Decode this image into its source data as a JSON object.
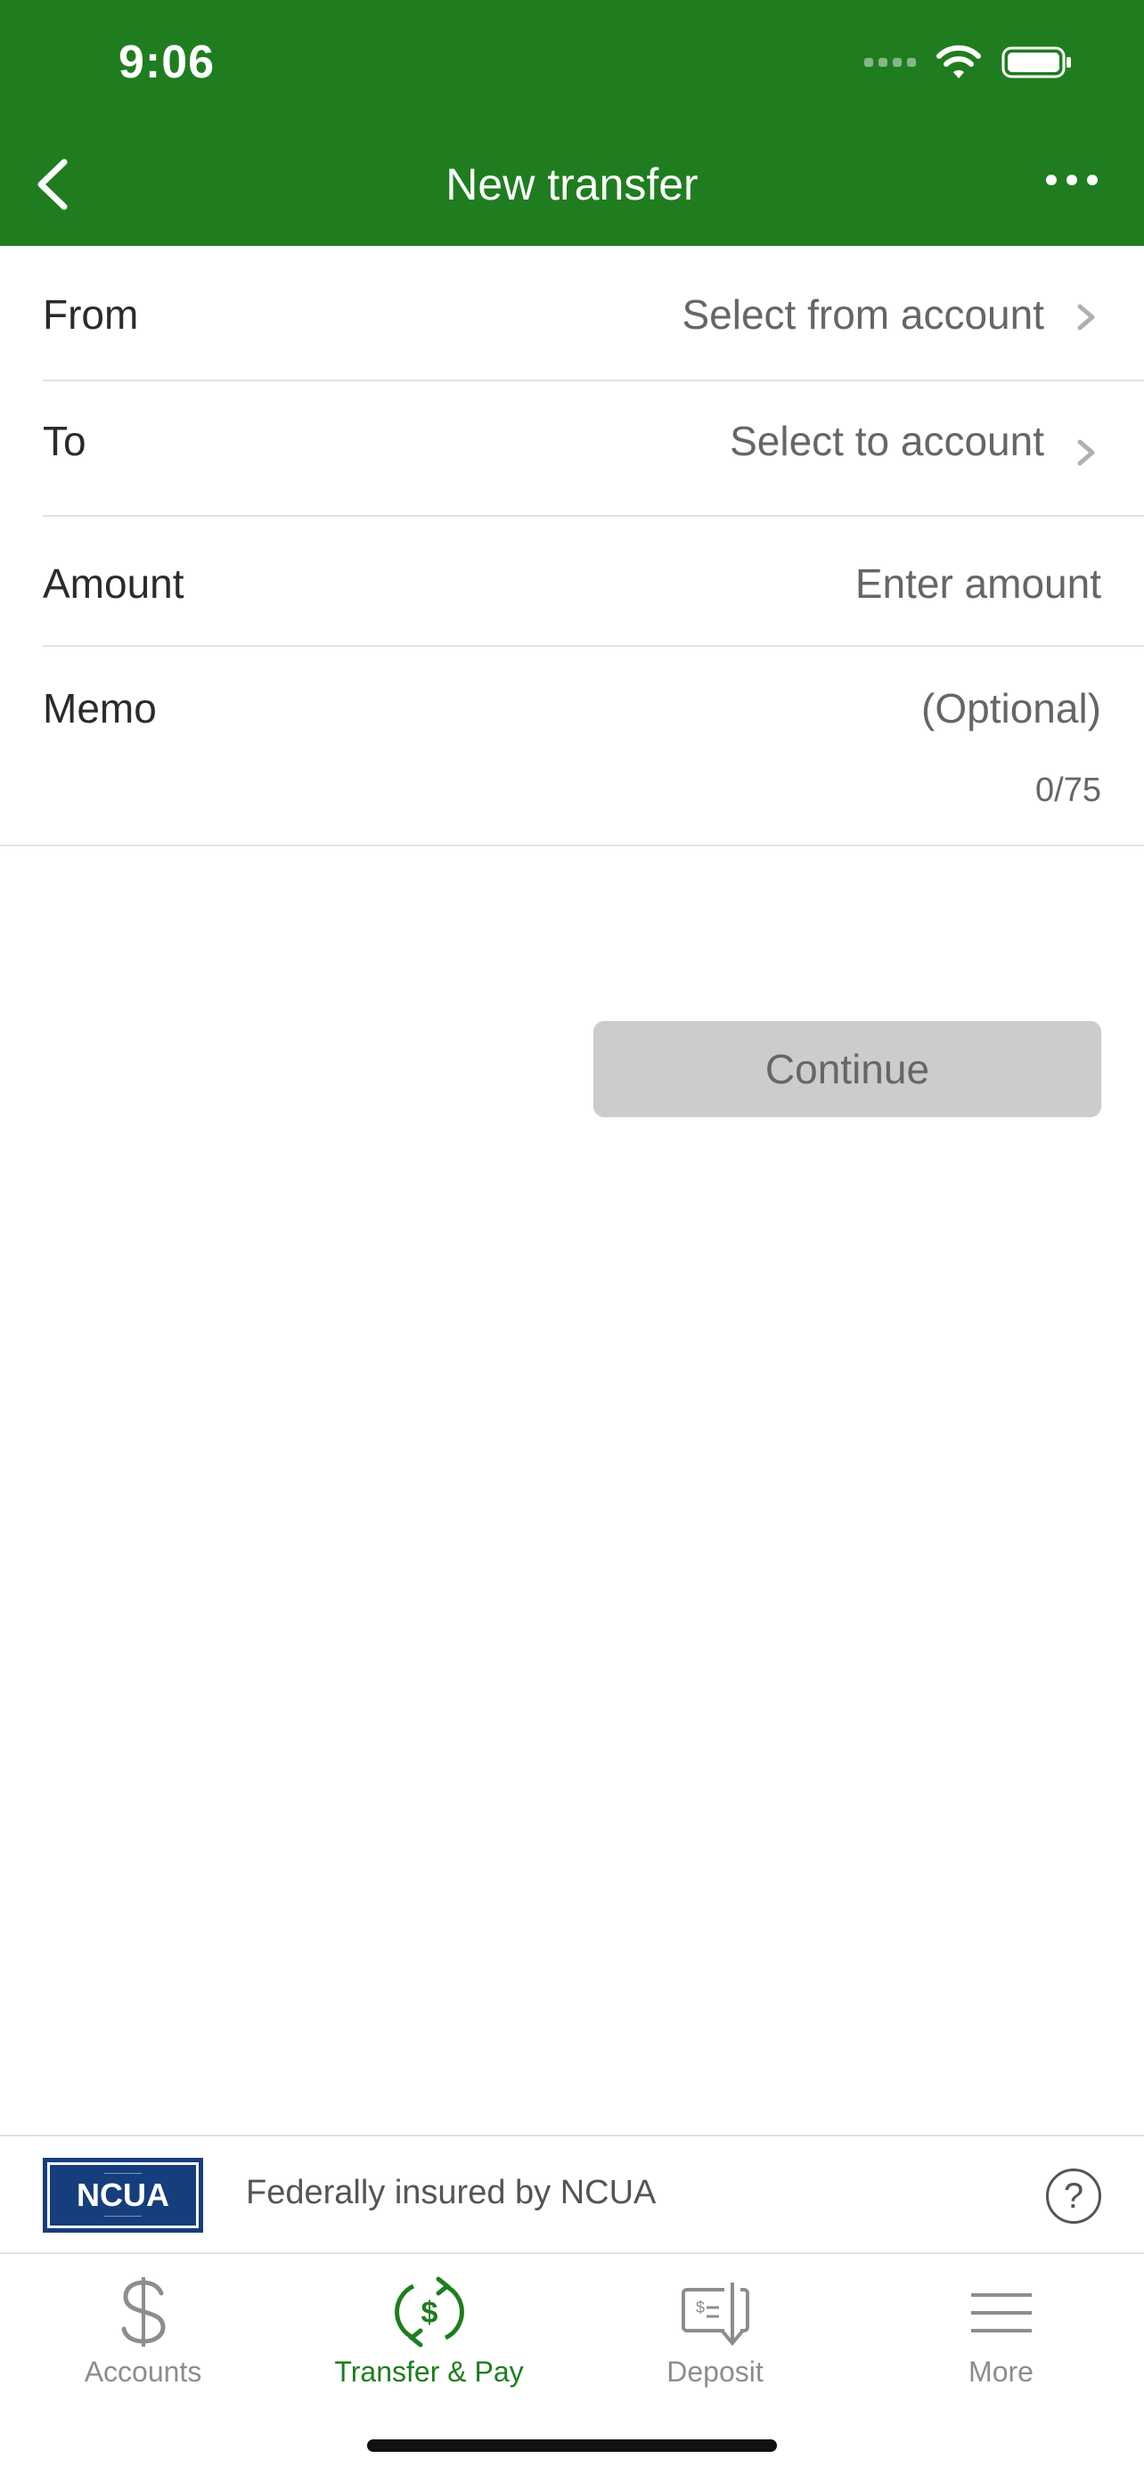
{
  "status_bar": {
    "time": "9:06"
  },
  "nav": {
    "title": "New transfer"
  },
  "form": {
    "from": {
      "label": "From",
      "value": "Select from account"
    },
    "to": {
      "label": "To",
      "value": "Select to account"
    },
    "amount": {
      "label": "Amount",
      "placeholder": "Enter amount"
    },
    "memo": {
      "label": "Memo",
      "placeholder": "(Optional)",
      "counter": "0/75"
    }
  },
  "actions": {
    "continue_label": "Continue"
  },
  "insurance": {
    "logo_text": "NCUA",
    "text": "Federally insured by NCUA",
    "help_label": "?"
  },
  "tabs": [
    {
      "label": "Accounts",
      "icon": "dollar-icon",
      "active": false
    },
    {
      "label": "Transfer & Pay",
      "icon": "transfer-pay-icon",
      "active": true
    },
    {
      "label": "Deposit",
      "icon": "deposit-check-icon",
      "active": false
    },
    {
      "label": "More",
      "icon": "menu-icon",
      "active": false
    }
  ],
  "colors": {
    "brand": "#1f7d1f",
    "disabled_button": "#cccccc",
    "ncua_blue": "#163e7d"
  }
}
